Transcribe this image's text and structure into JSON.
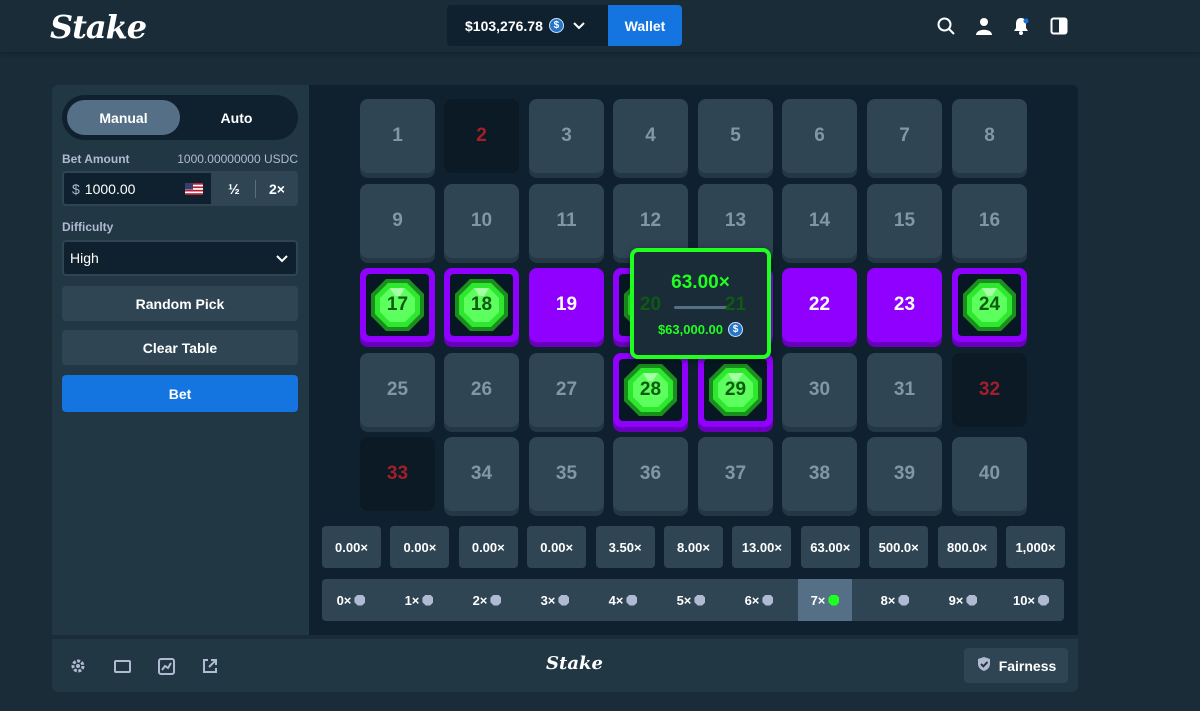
{
  "header": {
    "logo": "Stake",
    "balance": "$103,276.78",
    "currency_icon": "usdc-coin-icon",
    "wallet_label": "Wallet",
    "icons": [
      "search-icon",
      "user-icon",
      "notification-icon",
      "sidebar-toggle-icon"
    ]
  },
  "sidebar": {
    "tabs": [
      {
        "label": "Manual",
        "active": true
      },
      {
        "label": "Auto",
        "active": false
      }
    ],
    "bet_amount_label": "Bet Amount",
    "bet_amount_crypto": "1000.00000000 USDC",
    "bet_currency_symbol": "$",
    "bet_value": "1000.00",
    "half_label": "½",
    "double_label": "2×",
    "difficulty_label": "Difficulty",
    "difficulty_value": "High",
    "random_pick_label": "Random Pick",
    "clear_table_label": "Clear Table",
    "bet_button_label": "Bet"
  },
  "board": {
    "tiles": [
      {
        "n": "1",
        "state": "idle"
      },
      {
        "n": "2",
        "state": "miss"
      },
      {
        "n": "3",
        "state": "idle"
      },
      {
        "n": "4",
        "state": "idle"
      },
      {
        "n": "5",
        "state": "idle"
      },
      {
        "n": "6",
        "state": "idle"
      },
      {
        "n": "7",
        "state": "idle"
      },
      {
        "n": "8",
        "state": "idle"
      },
      {
        "n": "9",
        "state": "idle"
      },
      {
        "n": "10",
        "state": "idle"
      },
      {
        "n": "11",
        "state": "idle"
      },
      {
        "n": "12",
        "state": "idle"
      },
      {
        "n": "13",
        "state": "idle"
      },
      {
        "n": "14",
        "state": "idle"
      },
      {
        "n": "15",
        "state": "idle"
      },
      {
        "n": "16",
        "state": "idle"
      },
      {
        "n": "17",
        "state": "hit"
      },
      {
        "n": "18",
        "state": "hit"
      },
      {
        "n": "19",
        "state": "selected"
      },
      {
        "n": "20",
        "state": "hit"
      },
      {
        "n": "21",
        "state": "hit"
      },
      {
        "n": "22",
        "state": "selected"
      },
      {
        "n": "23",
        "state": "selected"
      },
      {
        "n": "24",
        "state": "hit"
      },
      {
        "n": "25",
        "state": "idle"
      },
      {
        "n": "26",
        "state": "idle"
      },
      {
        "n": "27",
        "state": "idle"
      },
      {
        "n": "28",
        "state": "hit"
      },
      {
        "n": "29",
        "state": "hit"
      },
      {
        "n": "30",
        "state": "idle"
      },
      {
        "n": "31",
        "state": "idle"
      },
      {
        "n": "32",
        "state": "miss"
      },
      {
        "n": "33",
        "state": "miss"
      },
      {
        "n": "34",
        "state": "idle"
      },
      {
        "n": "35",
        "state": "idle"
      },
      {
        "n": "36",
        "state": "idle"
      },
      {
        "n": "37",
        "state": "idle"
      },
      {
        "n": "38",
        "state": "idle"
      },
      {
        "n": "39",
        "state": "idle"
      },
      {
        "n": "40",
        "state": "idle"
      }
    ]
  },
  "win_popup": {
    "multiplier": "63.00×",
    "payout": "$63,000.00"
  },
  "payouts": [
    "0.00×",
    "0.00×",
    "0.00×",
    "0.00×",
    "3.50×",
    "8.00×",
    "13.00×",
    "63.00×",
    "500.0×",
    "800.0×",
    "1,000×"
  ],
  "hits": [
    {
      "label": "0×",
      "active": false
    },
    {
      "label": "1×",
      "active": false
    },
    {
      "label": "2×",
      "active": false
    },
    {
      "label": "3×",
      "active": false
    },
    {
      "label": "4×",
      "active": false
    },
    {
      "label": "5×",
      "active": false
    },
    {
      "label": "6×",
      "active": false
    },
    {
      "label": "7×",
      "active": true
    },
    {
      "label": "8×",
      "active": false
    },
    {
      "label": "9×",
      "active": false
    },
    {
      "label": "10×",
      "active": false
    }
  ],
  "footer": {
    "icons": [
      "settings-icon",
      "theatre-mode-icon",
      "live-stats-icon",
      "popout-icon"
    ],
    "logo": "Stake",
    "fairness_label": "Fairness"
  },
  "colors": {
    "background": "#1a2c38",
    "panel": "#213743",
    "board": "#0f212e",
    "accent_blue": "#1475e1",
    "selected_purple": "#9000ff",
    "gem_green": "#1fff20",
    "miss_red": "#a11f2a"
  }
}
